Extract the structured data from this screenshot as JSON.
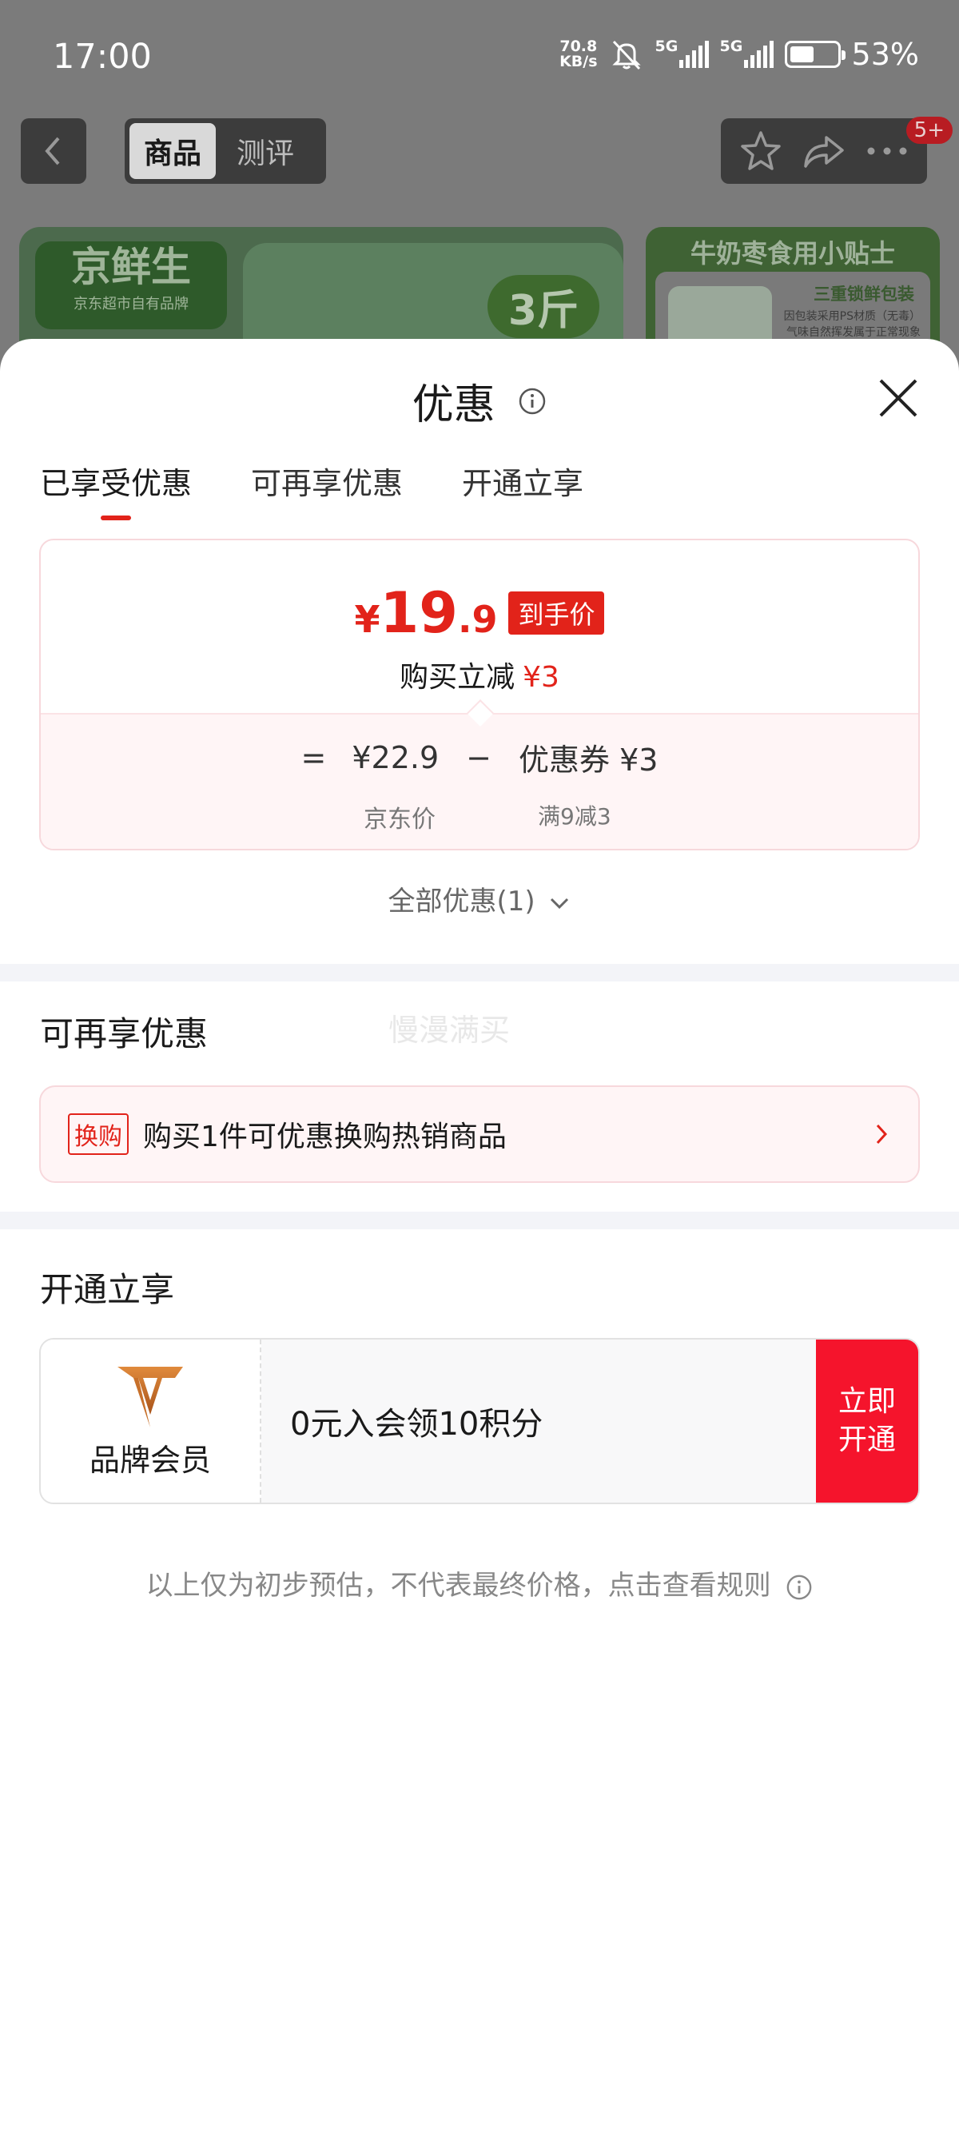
{
  "status_bar": {
    "time": "17:00",
    "net_speed_value": "70.8",
    "net_speed_unit": "KB/s",
    "signal1_label": "5G",
    "signal2_label": "5G",
    "battery_text": "53%",
    "battery_level": 0.53
  },
  "product_page": {
    "tabs": [
      "商品",
      "测评"
    ],
    "active_tab": "商品",
    "notification_badge": "5+",
    "banner_brand": "京鲜生",
    "banner_brand_sub": "京东超市自有品牌",
    "banner_weight": "3斤",
    "side_card_title": "牛奶枣食用小贴士",
    "side_card_pack": "三重锁鲜包装",
    "side_card_desc_1": "因包装采用PS材质（无毒）",
    "side_card_desc_2": "气味自然挥发属于正常现象"
  },
  "sheet": {
    "title": "优惠",
    "tabs": [
      "已享受优惠",
      "可再享优惠",
      "开通立享"
    ],
    "active_tab_index": 0,
    "price_card": {
      "currency": "¥",
      "price_int": "19",
      "price_dec": ".9",
      "final_badge": "到手价",
      "reduce_label": "购买立减",
      "reduce_amount": "¥3",
      "eq_sign": "=",
      "jd_price": "¥22.9",
      "minus_sign": "−",
      "coupon": "优惠券 ¥3",
      "jd_price_label": "京东价",
      "coupon_rule": "满9减3"
    },
    "all_offers": "全部优惠(1)",
    "section_more": {
      "heading": "可再享优惠",
      "watermark": "慢漫满买",
      "tag": "换购",
      "text": "购买1件可优惠换购热销商品"
    },
    "section_open": {
      "heading": "开通立享",
      "member_name": "品牌会员",
      "offer_text": "0元入会领10积分",
      "button_line1": "立即",
      "button_line2": "开通"
    },
    "disclaimer": "以上仅为初步预估，不代表最终价格，点击查看规则"
  },
  "colors": {
    "accent_red": "#e2231a",
    "button_red": "#f5142c",
    "overlay_gray": "#7b7b7b",
    "member_logo": "#b8651e"
  }
}
